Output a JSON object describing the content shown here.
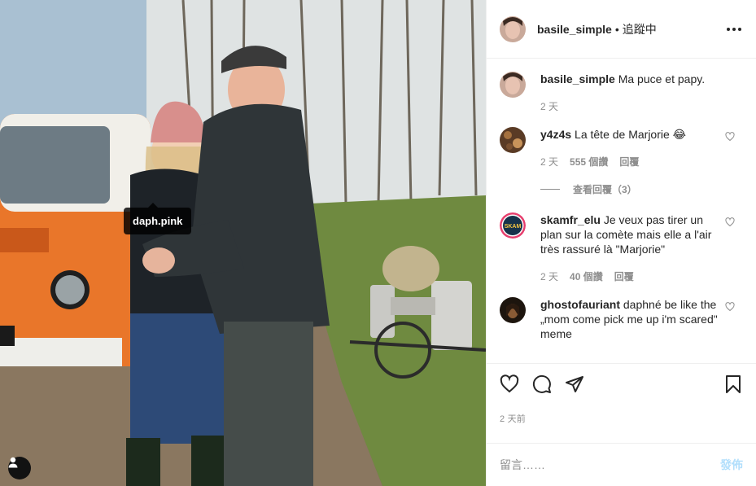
{
  "photo": {
    "tag_label": "daph.pink",
    "user_tag_icon": "person-icon"
  },
  "header": {
    "username": "basile_simple",
    "separator": "•",
    "follow_status": "追蹤中",
    "more_icon": "ellipsis-icon"
  },
  "caption": {
    "username": "basile_simple",
    "text": "Ma puce et papy.",
    "time": "2 天"
  },
  "comments": [
    {
      "username": "y4z4s",
      "text": "La tête de Marjorie 😂",
      "time": "2 天",
      "likes": "555 個讚",
      "reply": "回覆"
    },
    {
      "username": "skamfr_elu",
      "text": "Je veux pas tirer un plan sur la comète mais elle a l'air très rassuré là \"Marjorie\"",
      "time": "2 天",
      "likes": "40 個讚",
      "reply": "回覆"
    },
    {
      "username": "ghostofauriant",
      "text": "daphné be like the „mom come pick me up i'm scared\" meme"
    }
  ],
  "view_replies": "查看回覆（3）",
  "actions": {
    "like_icon": "heart-icon",
    "comment_icon": "comment-icon",
    "share_icon": "share-icon",
    "save_icon": "bookmark-icon"
  },
  "post_time": "2 天前",
  "add_comment": {
    "placeholder": "留言……",
    "post_label": "發佈"
  },
  "colors": {
    "text": "#262626",
    "muted": "#8e8e8e",
    "border": "#efefef",
    "post_disabled": "#b2dffc"
  }
}
